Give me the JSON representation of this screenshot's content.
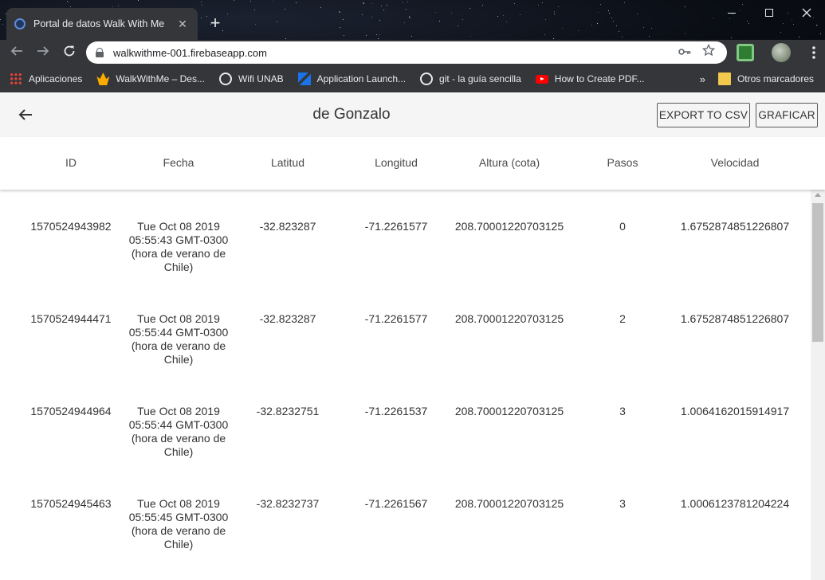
{
  "browser": {
    "tab_title": "Portal de datos Walk With Me",
    "tab_close": "✕",
    "new_tab": "+",
    "url": "walkwithme-001.firebaseapp.com",
    "bookmarks": [
      {
        "label": "Aplicaciones",
        "icon": "apps-grid-icon"
      },
      {
        "label": "WalkWithMe – Des...",
        "icon": "walkwithme-icon"
      },
      {
        "label": "Wifi UNAB",
        "icon": "globe-icon"
      },
      {
        "label": "Application Launch...",
        "icon": "app-launcher-icon"
      },
      {
        "label": "git - la guía sencilla",
        "icon": "globe-icon"
      },
      {
        "label": "How to Create PDF...",
        "icon": "youtube-icon"
      }
    ],
    "bookmarks_more": "»",
    "other_bookmarks": "Otros marcadores"
  },
  "header": {
    "title": "de Gonzalo",
    "export_label": "EXPORT TO CSV",
    "graph_label": "GRAFICAR"
  },
  "table": {
    "columns": [
      "ID",
      "Fecha",
      "Latitud",
      "Longitud",
      "Altura (cota)",
      "Pasos",
      "Velocidad"
    ],
    "rows": [
      {
        "id": "1570524943982",
        "fecha": "Tue Oct 08 2019 05:55:43 GMT-0300 (hora de verano de Chile)",
        "lat": "-32.823287",
        "lon": "-71.2261577",
        "alt": "208.70001220703125",
        "pasos": "0",
        "vel": "1.6752874851226807"
      },
      {
        "id": "1570524944471",
        "fecha": "Tue Oct 08 2019 05:55:44 GMT-0300 (hora de verano de Chile)",
        "lat": "-32.823287",
        "lon": "-71.2261577",
        "alt": "208.70001220703125",
        "pasos": "2",
        "vel": "1.6752874851226807"
      },
      {
        "id": "1570524944964",
        "fecha": "Tue Oct 08 2019 05:55:44 GMT-0300 (hora de verano de Chile)",
        "lat": "-32.8232751",
        "lon": "-71.2261537",
        "alt": "208.70001220703125",
        "pasos": "3",
        "vel": "1.0064162015914917"
      },
      {
        "id": "1570524945463",
        "fecha": "Tue Oct 08 2019 05:55:45 GMT-0300 (hora de verano de Chile)",
        "lat": "-32.8232737",
        "lon": "-71.2261567",
        "alt": "208.70001220703125",
        "pasos": "3",
        "vel": "1.0006123781204224"
      }
    ]
  },
  "colors": {
    "appbar_bg": "#f5f5f5",
    "text": "#333333",
    "chrome_bg": "#35363a"
  }
}
